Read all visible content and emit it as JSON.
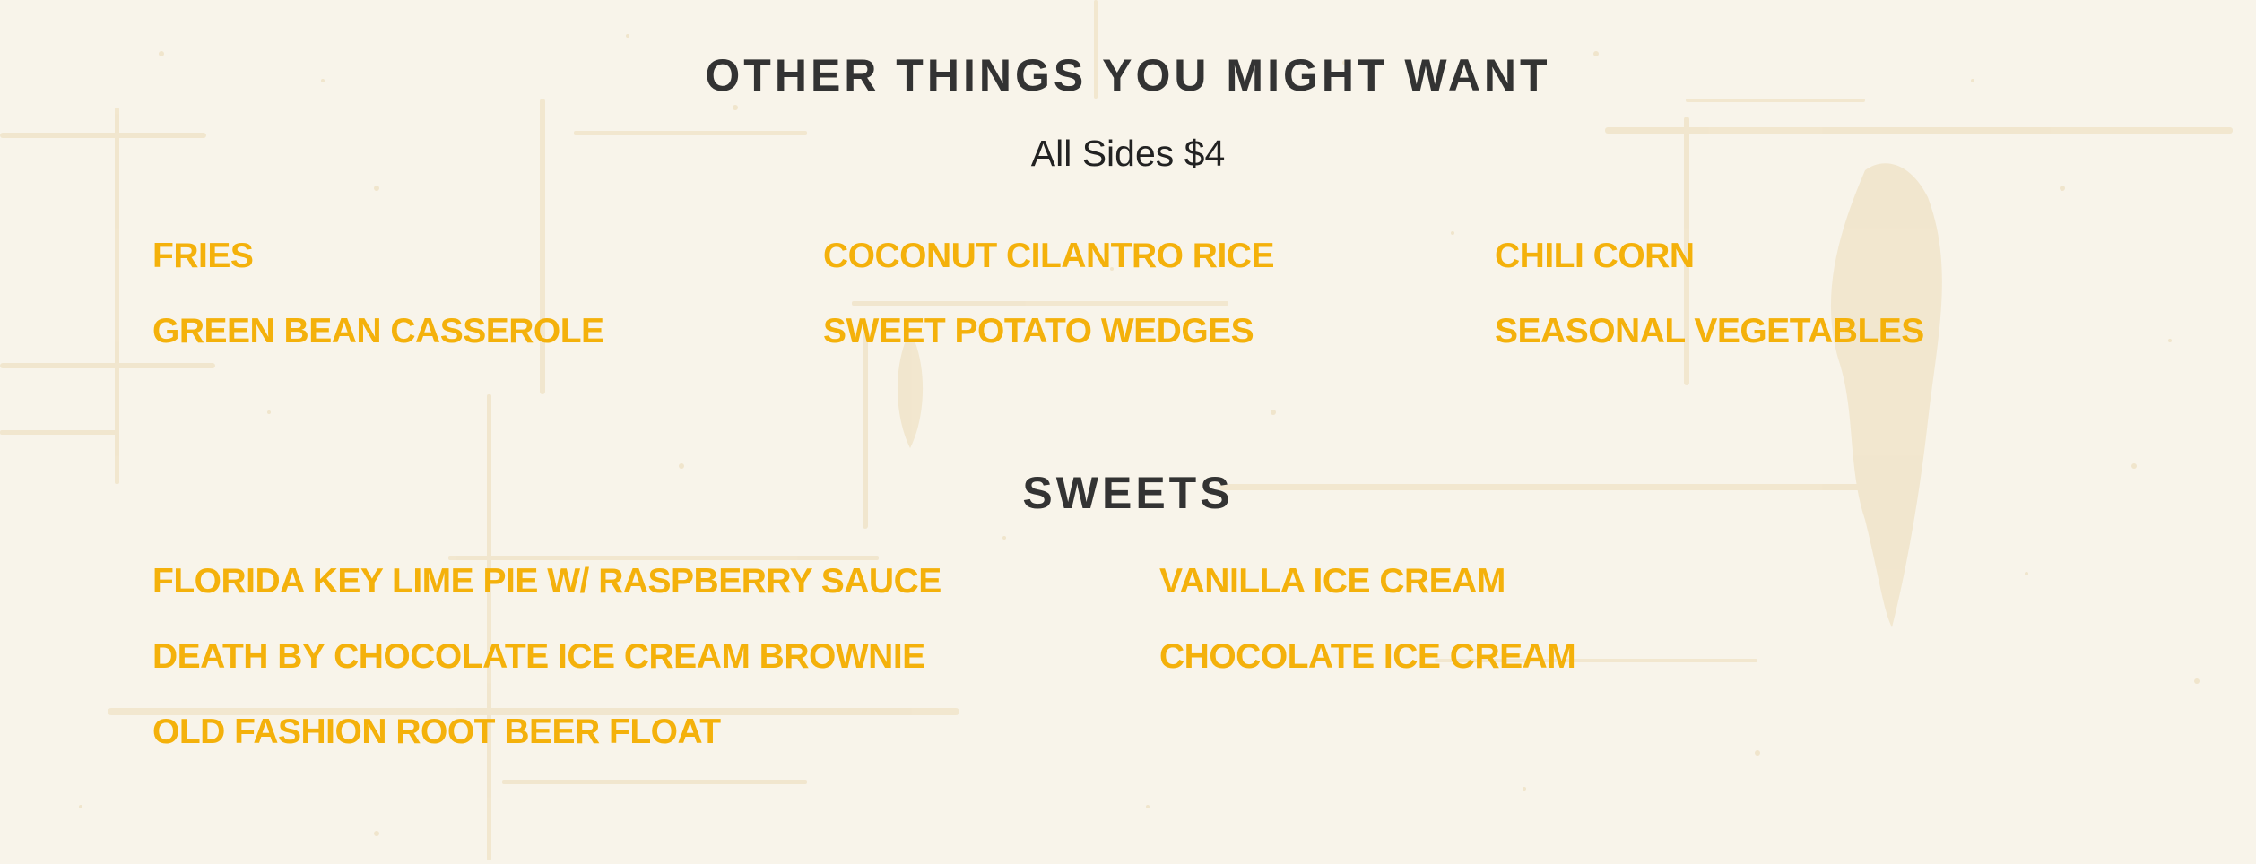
{
  "colors": {
    "background": "#f8f4ea",
    "heading": "#333333",
    "item": "#f4b10b",
    "texture": "#ecdcb8"
  },
  "sides_section": {
    "title": "OTHER THINGS YOU MIGHT WANT",
    "subtitle": "All Sides $4",
    "items": [
      {
        "label": "FRIES"
      },
      {
        "label": "COCONUT CILANTRO RICE"
      },
      {
        "label": "CHILI CORN"
      },
      {
        "label": "GREEN BEAN CASSEROLE"
      },
      {
        "label": "SWEET POTATO WEDGES"
      },
      {
        "label": "SEASONAL VEGETABLES"
      }
    ]
  },
  "sweets_section": {
    "title": "SWEETS",
    "items": [
      {
        "label": "FLORIDA KEY LIME PIE W/ RASPBERRY SAUCE"
      },
      {
        "label": "VANILLA ICE CREAM"
      },
      {
        "label": "DEATH BY CHOCOLATE ICE CREAM BROWNIE"
      },
      {
        "label": "CHOCOLATE ICE CREAM"
      },
      {
        "label": "OLD FASHION ROOT BEER FLOAT"
      }
    ]
  }
}
